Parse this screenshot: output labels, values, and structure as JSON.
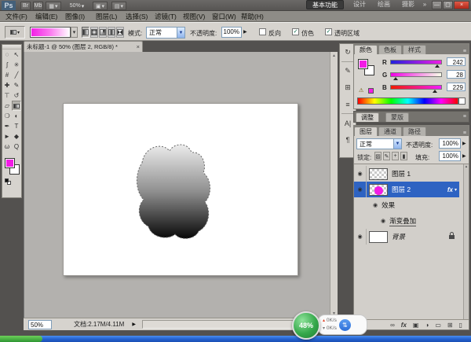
{
  "colors": {
    "foreground": "#F21CE5",
    "selection_blue": "#2E63C2",
    "taskbar_blue": "#2360CD",
    "badge_green": "#2F9E45",
    "blob_top": "#F2F2F2",
    "blob_bottom": "#000000"
  },
  "titlebar": {
    "logo": "Ps",
    "zoom": "50%",
    "bridge": "Br",
    "mini_bridge": "Mb",
    "view_extras": "▦",
    "arrange": "▣",
    "screen_mode": "▤",
    "dropdown": "▾",
    "workspaces": [
      "基本功能",
      "设计",
      "绘画",
      "摄影"
    ],
    "overflow": "»",
    "minimize": "—",
    "restore": "▢",
    "close": "×"
  },
  "menus": [
    "文件(F)",
    "编辑(E)",
    "图像(I)",
    "图层(L)",
    "选择(S)",
    "滤镜(T)",
    "视图(V)",
    "窗口(W)",
    "帮助(H)"
  ],
  "options": {
    "preset_arrow": "▾",
    "gradient_arrow": "▾",
    "mode_label": "模式:",
    "mode_value": "正常",
    "opacity_label": "不透明度:",
    "opacity_value": "100%",
    "spin": "▶",
    "reverse_label": "反向",
    "reverse_check": "",
    "dither_label": "仿色",
    "dither_check": "✓",
    "transparency_label": "透明区域",
    "transparency_check": "✓"
  },
  "doc": {
    "tab": "未标题-1 @ 50% (图层 2, RGB/8) *",
    "close": "×",
    "zoom": "50%",
    "info": "文档:2.17M/4.11M",
    "flyout": "▶"
  },
  "tools": [
    {
      "name": "elliptical-marquee",
      "glyph": "◌"
    },
    {
      "name": "move",
      "glyph": "↖"
    },
    {
      "name": "lasso",
      "glyph": "ʃ"
    },
    {
      "name": "quick-selection",
      "glyph": "✳"
    },
    {
      "name": "crop",
      "glyph": "#"
    },
    {
      "name": "eyedropper",
      "glyph": "╱"
    },
    {
      "name": "spot-healing",
      "glyph": "✚"
    },
    {
      "name": "brush",
      "glyph": "✎"
    },
    {
      "name": "clone-stamp",
      "glyph": "⊤"
    },
    {
      "name": "history-brush",
      "glyph": "↺"
    },
    {
      "name": "eraser",
      "glyph": "▱"
    },
    {
      "name": "gradient",
      "glyph": ""
    },
    {
      "name": "blur",
      "glyph": "❍"
    },
    {
      "name": "dodge",
      "glyph": "◐"
    },
    {
      "name": "pen",
      "glyph": "✒"
    },
    {
      "name": "type",
      "glyph": "T"
    },
    {
      "name": "path-selection",
      "glyph": "►"
    },
    {
      "name": "custom-shape",
      "glyph": "◆"
    },
    {
      "name": "hand",
      "glyph": "ω"
    },
    {
      "name": "zoom",
      "glyph": "Q"
    }
  ],
  "dock": [
    {
      "name": "history",
      "glyph": "↻"
    },
    {
      "name": "brush-panel",
      "glyph": "✎"
    },
    {
      "name": "clone-source",
      "glyph": "⊞"
    },
    {
      "name": "layer-comps",
      "glyph": "≡"
    },
    {
      "name": "character",
      "glyph": "A|"
    },
    {
      "name": "paragraph",
      "glyph": "¶"
    }
  ],
  "color_panel": {
    "tabs": [
      "颜色",
      "色板",
      "样式"
    ],
    "menu": "≡",
    "channels": [
      {
        "label": "R",
        "value": "242"
      },
      {
        "label": "G",
        "value": "28"
      },
      {
        "label": "B",
        "value": "229"
      }
    ],
    "warning": "⚠"
  },
  "adjust_panel": {
    "tab1": "调整",
    "tab2": "蒙版",
    "menu": "≡"
  },
  "layers_panel": {
    "tabs": [
      "图层",
      "通道",
      "路径"
    ],
    "menu": "≡",
    "mode_value": "正常",
    "opacity_label": "不透明度:",
    "opacity_value": "100%",
    "lock_label": "锁定:",
    "lock_icons": [
      "▨",
      "✎",
      "+",
      "▮"
    ],
    "fill_label": "填充:",
    "fill_value": "100%",
    "spin": "▶",
    "layer1": "图层 1",
    "layer2": "图层 2",
    "effects": "效果",
    "effect_item": "渐变叠加",
    "background_layer": "背景",
    "fx": "fx",
    "fx_arrow": "▾",
    "bottom_icons": [
      {
        "name": "link-layers",
        "glyph": "∞"
      },
      {
        "name": "layer-style",
        "glyph": "fx"
      },
      {
        "name": "layer-mask",
        "glyph": "▣"
      },
      {
        "name": "adjustment-layer",
        "glyph": "◑"
      },
      {
        "name": "new-group",
        "glyph": "▭"
      },
      {
        "name": "new-layer",
        "glyph": "⊞"
      },
      {
        "name": "delete-layer",
        "glyph": "▯"
      }
    ],
    "scroll_up": "▴"
  },
  "overlay": {
    "percent": "48%",
    "up": "0K/s",
    "down": "0K/s",
    "net": "⇅"
  }
}
